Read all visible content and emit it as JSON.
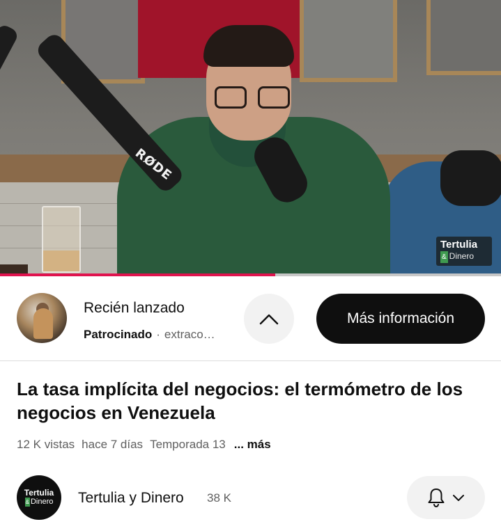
{
  "video": {
    "watermark_line1": "Tertulia",
    "watermark_amp": "&",
    "watermark_line2": "Dinero",
    "mic_brand": "RØDE",
    "progress_fraction": 0.55,
    "progress_color": "#e0134e"
  },
  "ad": {
    "title": "Recién lanzado",
    "sponsored": "Patrocinado",
    "separator": "·",
    "domain": "extraco…",
    "collapse_icon": "chevron-up-icon",
    "cta_label": "Más información"
  },
  "info": {
    "title": "La tasa implícita del negocios: el termómetro de los negocios en Venezuela",
    "views": "12 K vistas",
    "date": "hace 7 días",
    "season": "Temporada 13",
    "more_label": "... más"
  },
  "channel": {
    "avatar_line1": "Tertulia",
    "avatar_amp": "&",
    "avatar_line2": "Dinero",
    "name": "Tertulia y Dinero",
    "subscribers": "38 K",
    "bell_icon": "bell-icon",
    "dropdown_icon": "chevron-down-icon"
  }
}
